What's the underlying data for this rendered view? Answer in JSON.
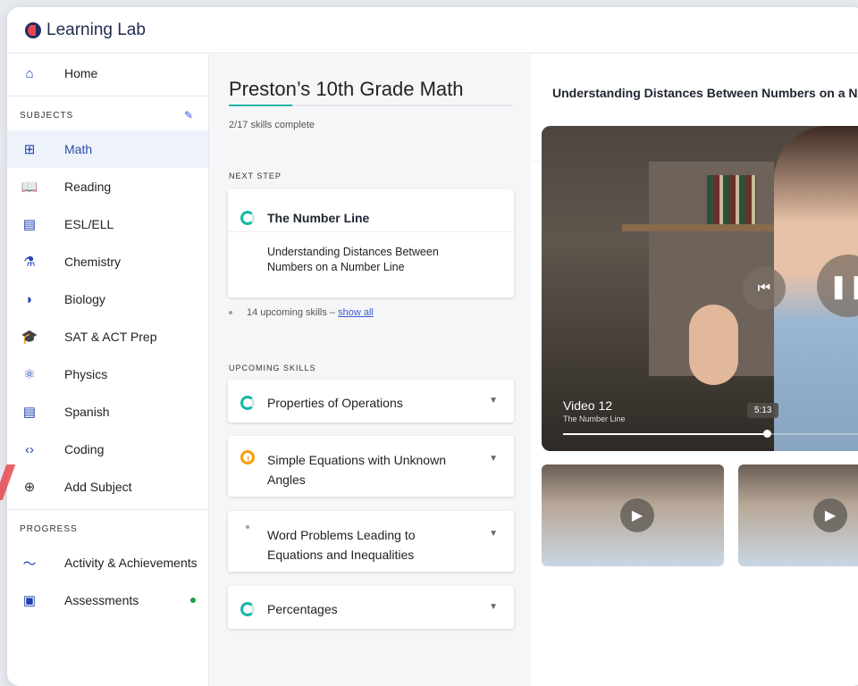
{
  "app": {
    "title": "Learning Lab"
  },
  "sidebar": {
    "home": "Home",
    "subjects_header": "SUBJECTS",
    "subjects": [
      {
        "label": "Math",
        "icon": "calculator-icon",
        "glyph": "⊞",
        "active": true
      },
      {
        "label": "Reading",
        "icon": "book-icon",
        "glyph": "📖"
      },
      {
        "label": "ESL/ELL",
        "icon": "chat-icon",
        "glyph": "▤"
      },
      {
        "label": "Chemistry",
        "icon": "flask-icon",
        "glyph": "⚗"
      },
      {
        "label": "Biology",
        "icon": "leaf-icon",
        "glyph": "◗"
      },
      {
        "label": "SAT & ACT Prep",
        "icon": "grad-cap-icon",
        "glyph": "🎓"
      },
      {
        "label": "Physics",
        "icon": "physics-icon",
        "glyph": "⚛"
      },
      {
        "label": "Spanish",
        "icon": "chat-icon",
        "glyph": "▤"
      },
      {
        "label": "Coding",
        "icon": "code-icon",
        "glyph": "‹›"
      }
    ],
    "add_subject": "Add Subject",
    "progress_header": "PROGRESS",
    "progress": [
      {
        "label": "Activity & Achievements",
        "icon": "trend-icon",
        "glyph": "〜"
      },
      {
        "label": "Assessments",
        "icon": "clipboard-icon",
        "glyph": "▣"
      }
    ]
  },
  "course": {
    "title": "Preston’s 10th Grade Math",
    "progress_fraction": 0.118,
    "skills_complete": "2/17 skills complete",
    "next_step_label": "NEXT STEP",
    "next_step_title": "The Number Line",
    "next_step_lesson": "Understanding Distances Between Numbers on a Number Line",
    "upcoming_count": "14 upcoming skills –",
    "show_all": "show all",
    "upcoming_label": "UPCOMING SKILLS",
    "upcoming": [
      {
        "title": "Properties of Operations"
      },
      {
        "title": "Simple Equations with Unknown Angles"
      },
      {
        "title": "Word Problems Leading to Equations and Inequalities"
      },
      {
        "title": "Percentages"
      }
    ]
  },
  "player": {
    "lesson_title": "Understanding Distances Between Numbers on a N",
    "video_title": "Video 12",
    "video_subtitle": "The Number Line",
    "time": "5:13",
    "progress_fraction": 0.67
  },
  "colors": {
    "accent": "#1e40af",
    "teal": "#14b8a6",
    "amber": "#f59e0b",
    "green": "#16a34a"
  }
}
